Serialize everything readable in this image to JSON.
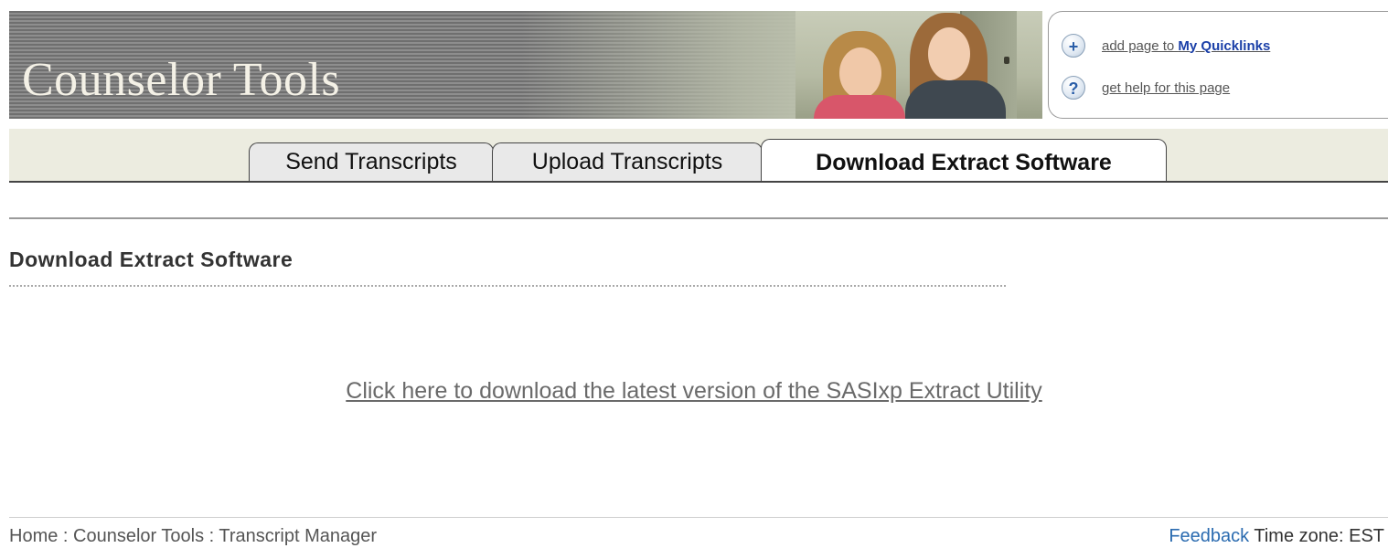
{
  "header": {
    "title": "Counselor Tools",
    "quicklinks": {
      "add_prefix": "add page to ",
      "add_accent": "My Quicklinks",
      "help_label": "get help for this page",
      "add_icon": "plus-icon",
      "help_icon": "question-icon"
    }
  },
  "tabs": [
    {
      "label": "Send Transcripts",
      "active": false
    },
    {
      "label": "Upload Transcripts",
      "active": false
    },
    {
      "label": "Download Extract Software",
      "active": true
    }
  ],
  "main": {
    "section_title": "Download Extract Software",
    "download_link": "Click here to download the latest version of the SASIxp Extract Utility"
  },
  "footer": {
    "breadcrumb": [
      "Home",
      "Counselor Tools",
      "Transcript Manager"
    ],
    "separator": " : ",
    "feedback": "Feedback",
    "timezone": "Time zone: EST"
  },
  "colors": {
    "tabbar_bg": "#ecece0",
    "link_blue": "#2a6bb0",
    "quicklink_accent": "#1a3fa8"
  }
}
